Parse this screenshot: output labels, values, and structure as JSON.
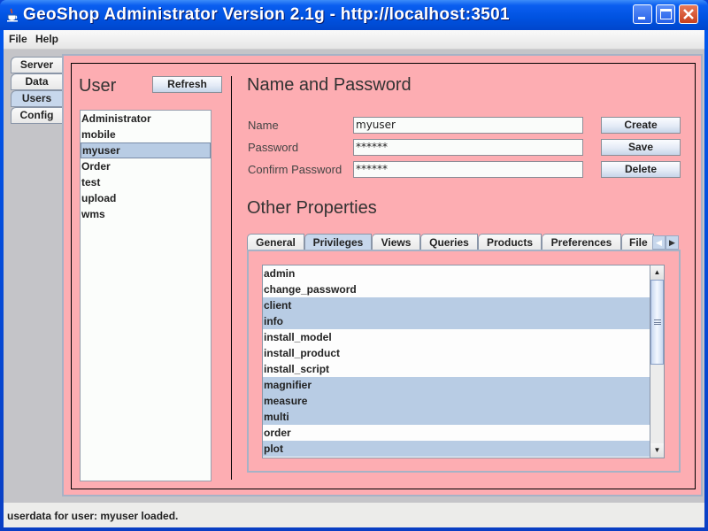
{
  "window": {
    "title": "GeoShop Administrator Version 2.1g - http://localhost:3501",
    "controls": {
      "minimize": "_",
      "maximize": "□",
      "close": "✕"
    }
  },
  "menubar": {
    "items": [
      "File",
      "Help"
    ]
  },
  "side_tabs": {
    "items": [
      {
        "label": "Server",
        "active": false
      },
      {
        "label": "Data",
        "active": false
      },
      {
        "label": "Users",
        "active": true
      },
      {
        "label": "Config",
        "active": false
      }
    ]
  },
  "user_panel": {
    "heading": "User",
    "refresh_label": "Refresh",
    "users": [
      "Administrator",
      "mobile",
      "myuser",
      "Order",
      "test",
      "upload",
      "wms"
    ],
    "selected_user": "myuser"
  },
  "name_password": {
    "heading": "Name and Password",
    "name_label": "Name",
    "name_value": "myuser",
    "password_label": "Password",
    "password_value": "******",
    "confirm_label": "Confirm Password",
    "confirm_value": "******",
    "create_label": "Create",
    "save_label": "Save",
    "delete_label": "Delete"
  },
  "other_properties": {
    "heading": "Other Properties",
    "tabs": [
      {
        "label": "General",
        "active": false
      },
      {
        "label": "Privileges",
        "active": true
      },
      {
        "label": "Views",
        "active": false
      },
      {
        "label": "Queries",
        "active": false
      },
      {
        "label": "Products",
        "active": false
      },
      {
        "label": "Preferences",
        "active": false
      },
      {
        "label": "File",
        "active": false
      }
    ],
    "tab_scroll_left": "◀",
    "tab_scroll_right": "▶",
    "privileges": [
      {
        "name": "admin",
        "selected": false
      },
      {
        "name": "change_password",
        "selected": false
      },
      {
        "name": "client",
        "selected": true
      },
      {
        "name": "info",
        "selected": true
      },
      {
        "name": "install_model",
        "selected": false
      },
      {
        "name": "install_product",
        "selected": false
      },
      {
        "name": "install_script",
        "selected": false
      },
      {
        "name": "magnifier",
        "selected": true
      },
      {
        "name": "measure",
        "selected": true
      },
      {
        "name": "multi",
        "selected": true
      },
      {
        "name": "order",
        "selected": false
      },
      {
        "name": "plot",
        "selected": true
      }
    ],
    "scroll_up": "▲",
    "scroll_down": "▼"
  },
  "status": {
    "text": "userdata for user: myuser loaded."
  },
  "colors": {
    "panel_bg": "#fdadb2",
    "selection": "#b8cce4",
    "titlebar": "#0052e0"
  }
}
